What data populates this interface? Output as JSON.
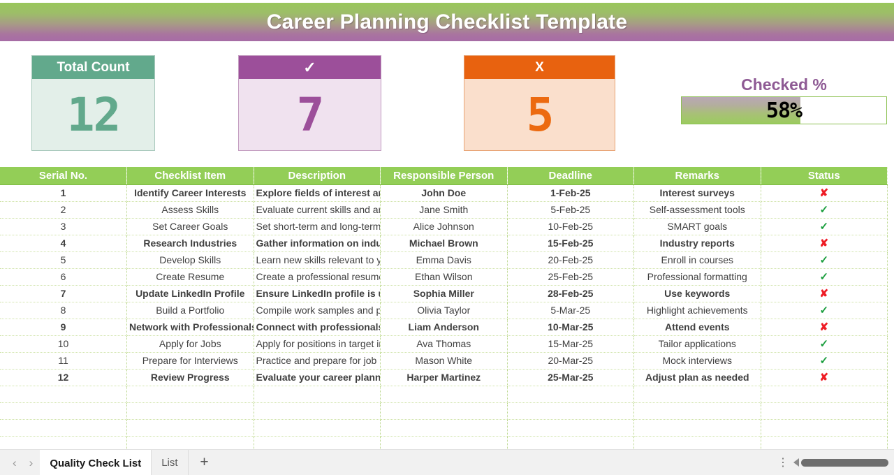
{
  "banner": {
    "title": "Career Planning Checklist Template"
  },
  "cards": [
    {
      "name": "total-count",
      "label": "Total Count",
      "value": "12",
      "head_color": "#62a98c",
      "body_color": "#e3efe9"
    },
    {
      "name": "checked",
      "label": "✓",
      "value": "7",
      "head_color": "#9c4f9a",
      "body_color": "#f0e2ef"
    },
    {
      "name": "unchecked",
      "label": "X",
      "value": "5",
      "head_color": "#e8620f",
      "body_color": "#fadfcc"
    }
  ],
  "gauge": {
    "label": "Checked %",
    "value": "58%",
    "percent": 58,
    "fill_start": "#b9a8b6",
    "fill_end": "#9ccb5f",
    "border": "#8cc152"
  },
  "table": {
    "headers": [
      "Serial No.",
      "Checklist Item",
      "Description",
      "Responsible Person",
      "Deadline",
      "Remarks",
      "Status"
    ],
    "header_bg": "#93ce57",
    "flag_color": "#ee1c25",
    "tick_color": "#1a9e3d",
    "rows": [
      {
        "serial": "1",
        "item": "Identify Career Interests",
        "description": "Explore fields of interest and passion",
        "person": "John Doe",
        "deadline": "1-Feb-25",
        "remarks": "Interest surveys",
        "status": "✘",
        "flag": true
      },
      {
        "serial": "2",
        "item": "Assess Skills",
        "description": "Evaluate current skills and areas to improve",
        "person": "Jane Smith",
        "deadline": "5-Feb-25",
        "remarks": "Self-assessment tools",
        "status": "✓",
        "flag": false
      },
      {
        "serial": "3",
        "item": "Set Career Goals",
        "description": "Set short-term and long-term career objectives",
        "person": "Alice Johnson",
        "deadline": "10-Feb-25",
        "remarks": "SMART goals",
        "status": "✓",
        "flag": false
      },
      {
        "serial": "4",
        "item": "Research Industries",
        "description": "Gather information on industries of interest",
        "person": "Michael Brown",
        "deadline": "15-Feb-25",
        "remarks": "Industry reports",
        "status": "✘",
        "flag": true
      },
      {
        "serial": "5",
        "item": "Develop Skills",
        "description": "Learn new skills relevant to your goals",
        "person": "Emma Davis",
        "deadline": "20-Feb-25",
        "remarks": "Enroll in courses",
        "status": "✓",
        "flag": false
      },
      {
        "serial": "6",
        "item": "Create Resume",
        "description": "Create a professional resume",
        "person": "Ethan Wilson",
        "deadline": "25-Feb-25",
        "remarks": "Professional formatting",
        "status": "✓",
        "flag": false
      },
      {
        "serial": "7",
        "item": "Update LinkedIn Profile",
        "description": "Ensure LinkedIn profile is up-to-date",
        "person": "Sophia Miller",
        "deadline": "28-Feb-25",
        "remarks": "Use keywords",
        "status": "✘",
        "flag": true
      },
      {
        "serial": "8",
        "item": "Build a Portfolio",
        "description": "Compile work samples and projects",
        "person": "Olivia Taylor",
        "deadline": "5-Mar-25",
        "remarks": "Highlight achievements",
        "status": "✓",
        "flag": false
      },
      {
        "serial": "9",
        "item": "Network with Professionals",
        "description": "Connect with professionals in your field",
        "person": "Liam Anderson",
        "deadline": "10-Mar-25",
        "remarks": "Attend events",
        "status": "✘",
        "flag": true
      },
      {
        "serial": "10",
        "item": "Apply for Jobs",
        "description": "Apply for positions in target industries",
        "person": "Ava Thomas",
        "deadline": "15-Mar-25",
        "remarks": "Tailor applications",
        "status": "✓",
        "flag": false
      },
      {
        "serial": "11",
        "item": "Prepare for Interviews",
        "description": "Practice and prepare for job interviews",
        "person": "Mason White",
        "deadline": "20-Mar-25",
        "remarks": "Mock interviews",
        "status": "✓",
        "flag": false
      },
      {
        "serial": "12",
        "item": "Review Progress",
        "description": "Evaluate your career planning efforts",
        "person": "Harper Martinez",
        "deadline": "25-Mar-25",
        "remarks": "Adjust plan as needed",
        "status": "✘",
        "flag": true
      }
    ],
    "empty_row_count": 4
  },
  "bottombar": {
    "prev_label": "‹",
    "next_label": "›",
    "tabs": [
      {
        "label": "Quality Check List",
        "active": true
      },
      {
        "label": "List",
        "active": false
      }
    ],
    "add_label": "+",
    "kebab_label": "⋮"
  }
}
